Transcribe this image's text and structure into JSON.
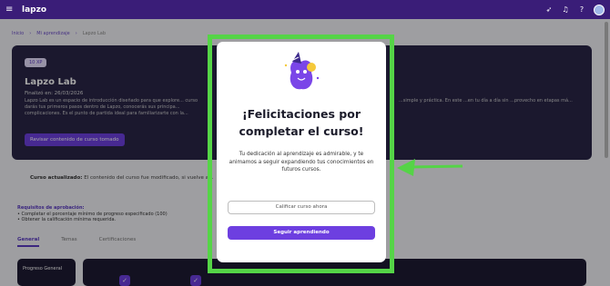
{
  "topbar": {
    "logo": "lapzo",
    "menu_icon": "hamburger-icon",
    "right_icons": [
      "rocket-icon",
      "bell-icon",
      "help-icon"
    ]
  },
  "breadcrumb": [
    "Inicio",
    "Mi aprendizaje",
    "Lapzo Lab"
  ],
  "hero": {
    "badge": "10 XP",
    "title": "Lapzo Lab",
    "finished": "Finalizó en: 26/03/2026",
    "desc_left": "Lapzo Lab es un espacio de introducción diseñado para que explore... curso darás tus primeros pasos dentro de Lapzo, conocerás sus principa... complicaciones. Es el punto de partida ideal para familiarizarte con la...",
    "desc_right": "...simple y práctica. En este ...en tu día a día sin ...provecho en etapas má...",
    "review_button": "Revisar contenido de curso tomado"
  },
  "update_notice": {
    "label": "Curso actualizado:",
    "text": "El contenido del curso fue modificado, si vuelve a..."
  },
  "requirements": {
    "heading": "Requisitos de aprobación:",
    "items": [
      "• Completar el porcentaje mínimo de progreso especificado (100)",
      "• Obtener la calificación mínima requerida."
    ]
  },
  "tabs": [
    "General",
    "Temas",
    "Certificaciones"
  ],
  "progress_card": {
    "label": "Progreso General"
  },
  "modal": {
    "title": "¡Felicitaciones por completar el curso!",
    "message": "Tu dedicación al aprendizaje es admirable, y te animamos a seguir expandiendo tus conocimientos en futuros cursos.",
    "rate_button": "Calificar curso ahora",
    "continue_button": "Seguir aprendiendo"
  },
  "colors": {
    "brand_purple": "#6d3fe0",
    "topbar": "#3a1d78",
    "highlight_green": "#55d447"
  }
}
